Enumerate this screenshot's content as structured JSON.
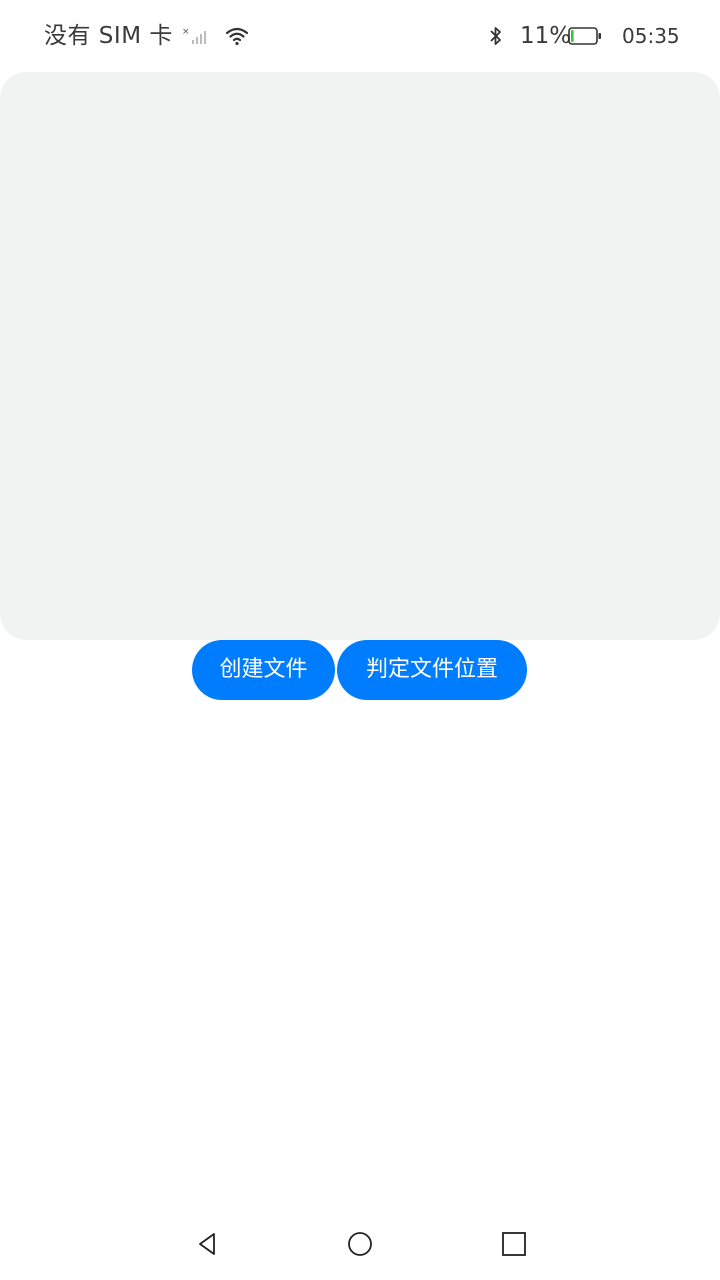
{
  "status_bar": {
    "carrier": "没有 SIM 卡",
    "battery_percent": "11%",
    "battery_level": 0.11,
    "time": "05:35",
    "icons": [
      "signal-icon",
      "wifi-icon",
      "bluetooth-icon",
      "battery-icon"
    ]
  },
  "buttons": {
    "create_file": "创建文件",
    "locate_file": "判定文件位置"
  },
  "colors": {
    "accent": "#007dff",
    "panel_bg": "#f1f3f2",
    "battery_fill": "#3cc24b"
  },
  "nav_bar": {
    "icons": [
      "back-icon",
      "home-icon",
      "recent-apps-icon"
    ]
  }
}
